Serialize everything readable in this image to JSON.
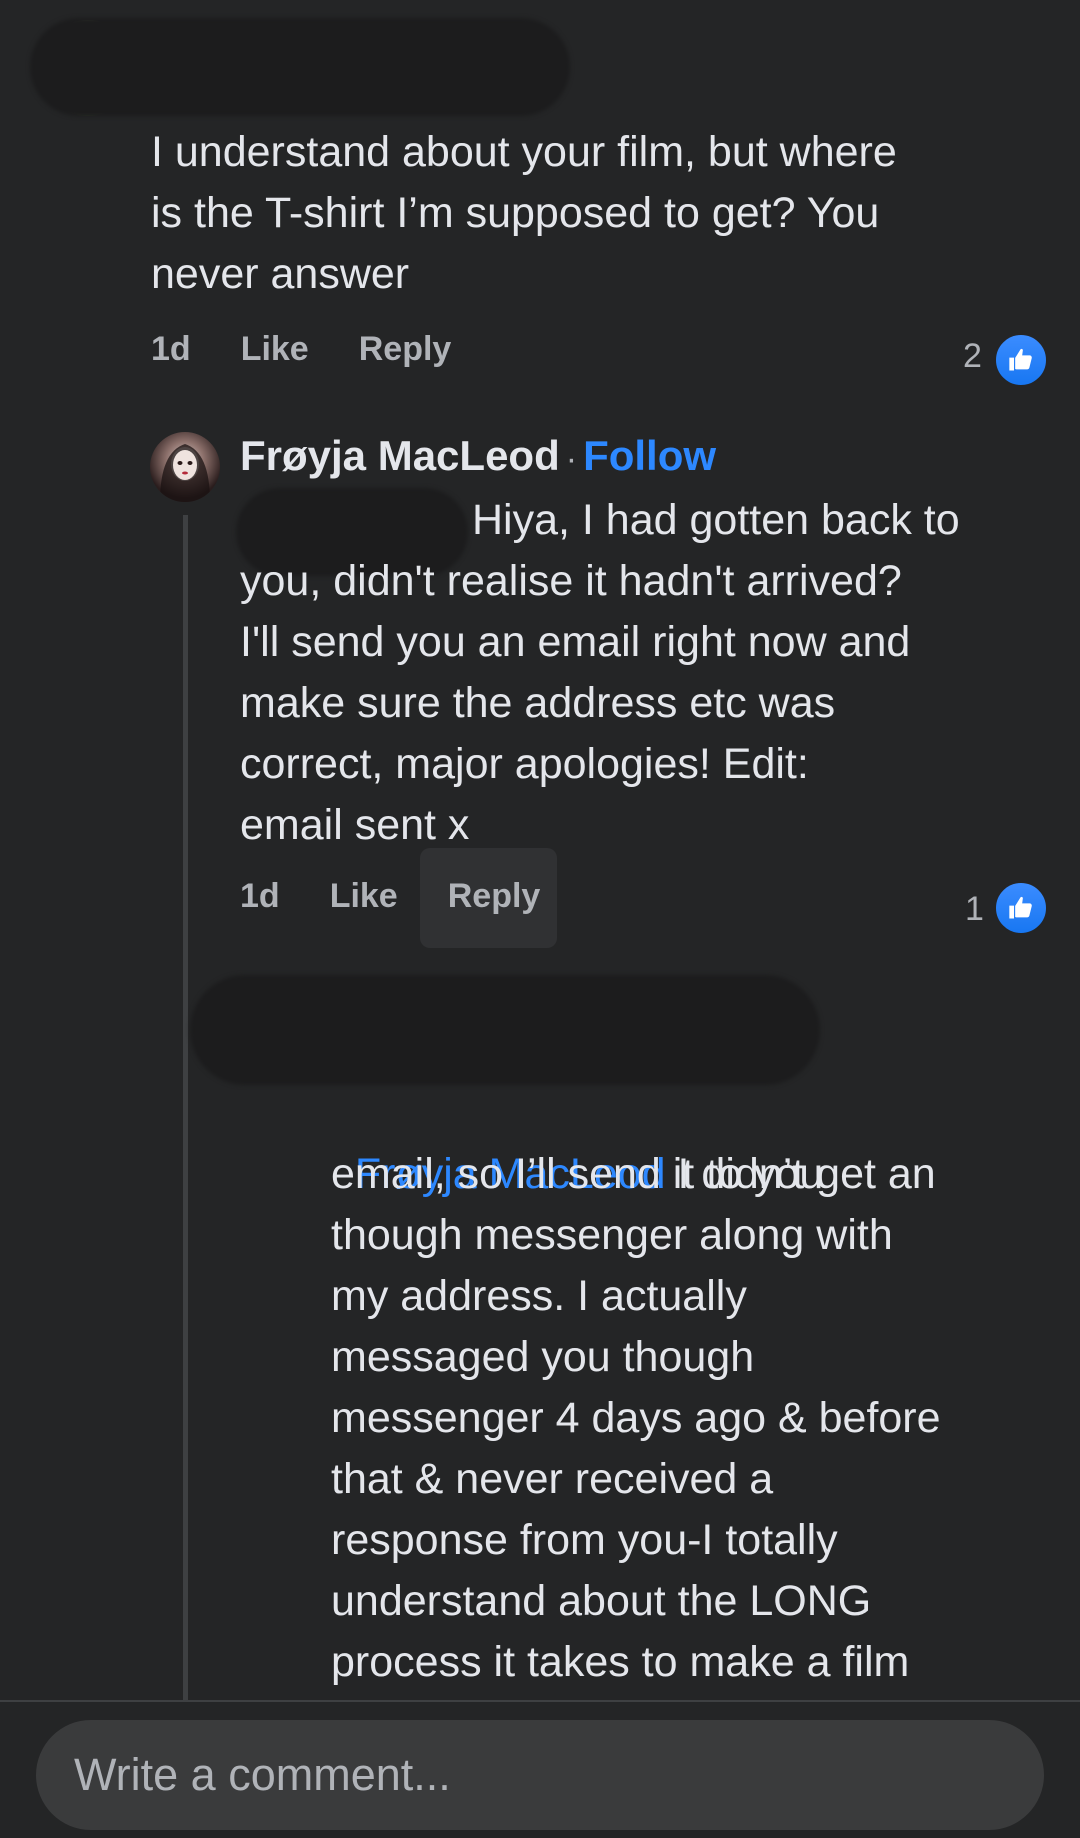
{
  "top_comment": {
    "text": "I understand about your film, but where\nis the T-shirt I’m supposed to get? You\nnever answer",
    "time": "1d",
    "like_label": "Like",
    "reply_label": "Reply",
    "reaction_count": "2"
  },
  "reply_comment": {
    "author": "Frøyja MacLeod",
    "separator": "·",
    "follow_label": "Follow",
    "text_line1": "Hiya, I had gotten back to",
    "text_line2_fragment": "you, didn't realise it hadn't arrived?",
    "text_rest": "I'll send you an email right now and\nmake sure the address etc was\ncorrect, major apologies! Edit:\nemail sent x",
    "time": "1d",
    "like_label": "Like",
    "reply_label": "Reply",
    "reaction_count": "1"
  },
  "nested_reply": {
    "mention": "Frøyja MacLeod",
    "text_first_line": " I didn’t get an",
    "text_rest": "email, so I’ll send it to you\nthough messenger along with\nmy address. I actually\nmessaged you though\nmessenger 4 days ago & before\nthat & never received a\nresponse from you-I totally\nunderstand about the LONG\nprocess it takes to make a film"
  },
  "composer": {
    "placeholder": "Write a comment..."
  },
  "colors": {
    "background": "#242526",
    "link_blue": "#2d88ff",
    "like_blue": "#1877f2"
  }
}
